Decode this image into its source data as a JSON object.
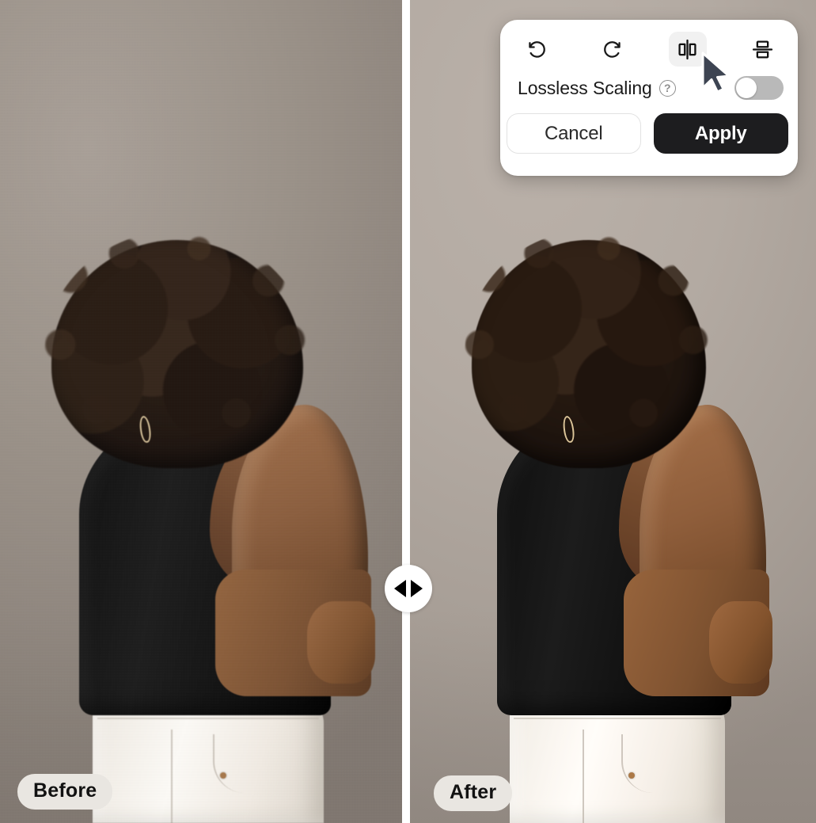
{
  "comparison": {
    "before": {
      "badge": "Before"
    },
    "after": {
      "badge": "After"
    },
    "handle": {
      "left_arrow": "◀",
      "right_arrow": "▶"
    }
  },
  "edit_panel": {
    "tools": [
      {
        "name": "undo",
        "label": "Undo",
        "icon": "rotate-ccw-icon",
        "active": false
      },
      {
        "name": "redo",
        "label": "Redo",
        "icon": "rotate-cw-icon",
        "active": false
      },
      {
        "name": "flip-horizontal",
        "label": "Flip Horizontal",
        "icon": "flip-horizontal-icon",
        "active": true
      },
      {
        "name": "flip-vertical",
        "label": "Flip Vertical",
        "icon": "flip-vertical-icon",
        "active": false
      }
    ],
    "option": {
      "label": "Lossless Scaling",
      "help": "?",
      "toggle_state": "off"
    },
    "actions": {
      "cancel_label": "Cancel",
      "apply_label": "Apply"
    }
  },
  "colors": {
    "panel_background": "#ffffff",
    "apply_button": "#1d1d1f",
    "apply_text": "#ffffff",
    "cancel_border": "#e2e2e2",
    "tool_active_background": "#f1f1f1",
    "toggle_off_track": "#b9b9b9",
    "toggle_knob": "#ffffff",
    "badge_background": "#e9e6e1",
    "badge_text": "#121212",
    "divider": "#ffffff",
    "before_backdrop": "#9b9289",
    "after_backdrop": "#b3aaa2",
    "cursor": "#3d4452"
  }
}
